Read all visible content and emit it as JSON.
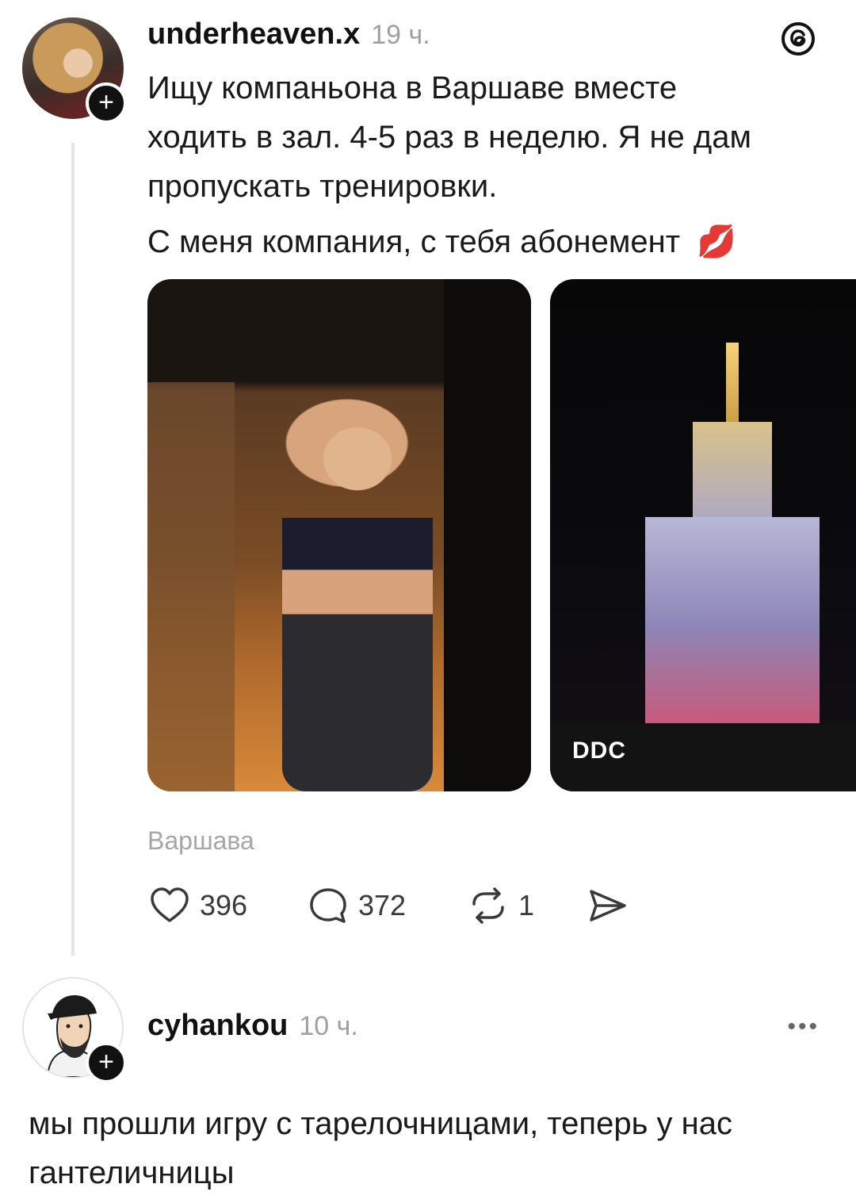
{
  "post": {
    "username": "underheaven.x",
    "time": "19 ч.",
    "text_lines": [
      "Ищу компаньона в Варшаве вместе",
      "ходить в зал. 4-5 раз в неделю. Я не дам",
      "пропускать тренировки."
    ],
    "text_second": "С меня компания, с тебя абонемент",
    "emoji": "💋",
    "photo_caption": "DDC",
    "location": "Варшава",
    "likes": "396",
    "comments": "372",
    "reposts": "1"
  },
  "comment": {
    "username": "cyhankou",
    "time": "10 ч.",
    "more": "•••",
    "text": "мы прошли игру с тарелочницами, теперь у нас гантеличницы"
  },
  "icons": {
    "app_logo": "threads-logo-icon",
    "follow": "plus-icon",
    "like": "heart-icon",
    "comment": "comment-bubble-icon",
    "repost": "repost-icon",
    "share": "send-icon"
  },
  "colors": {
    "text": "#1a1a1a",
    "muted": "#a0a0a0",
    "badge": "#111111"
  }
}
